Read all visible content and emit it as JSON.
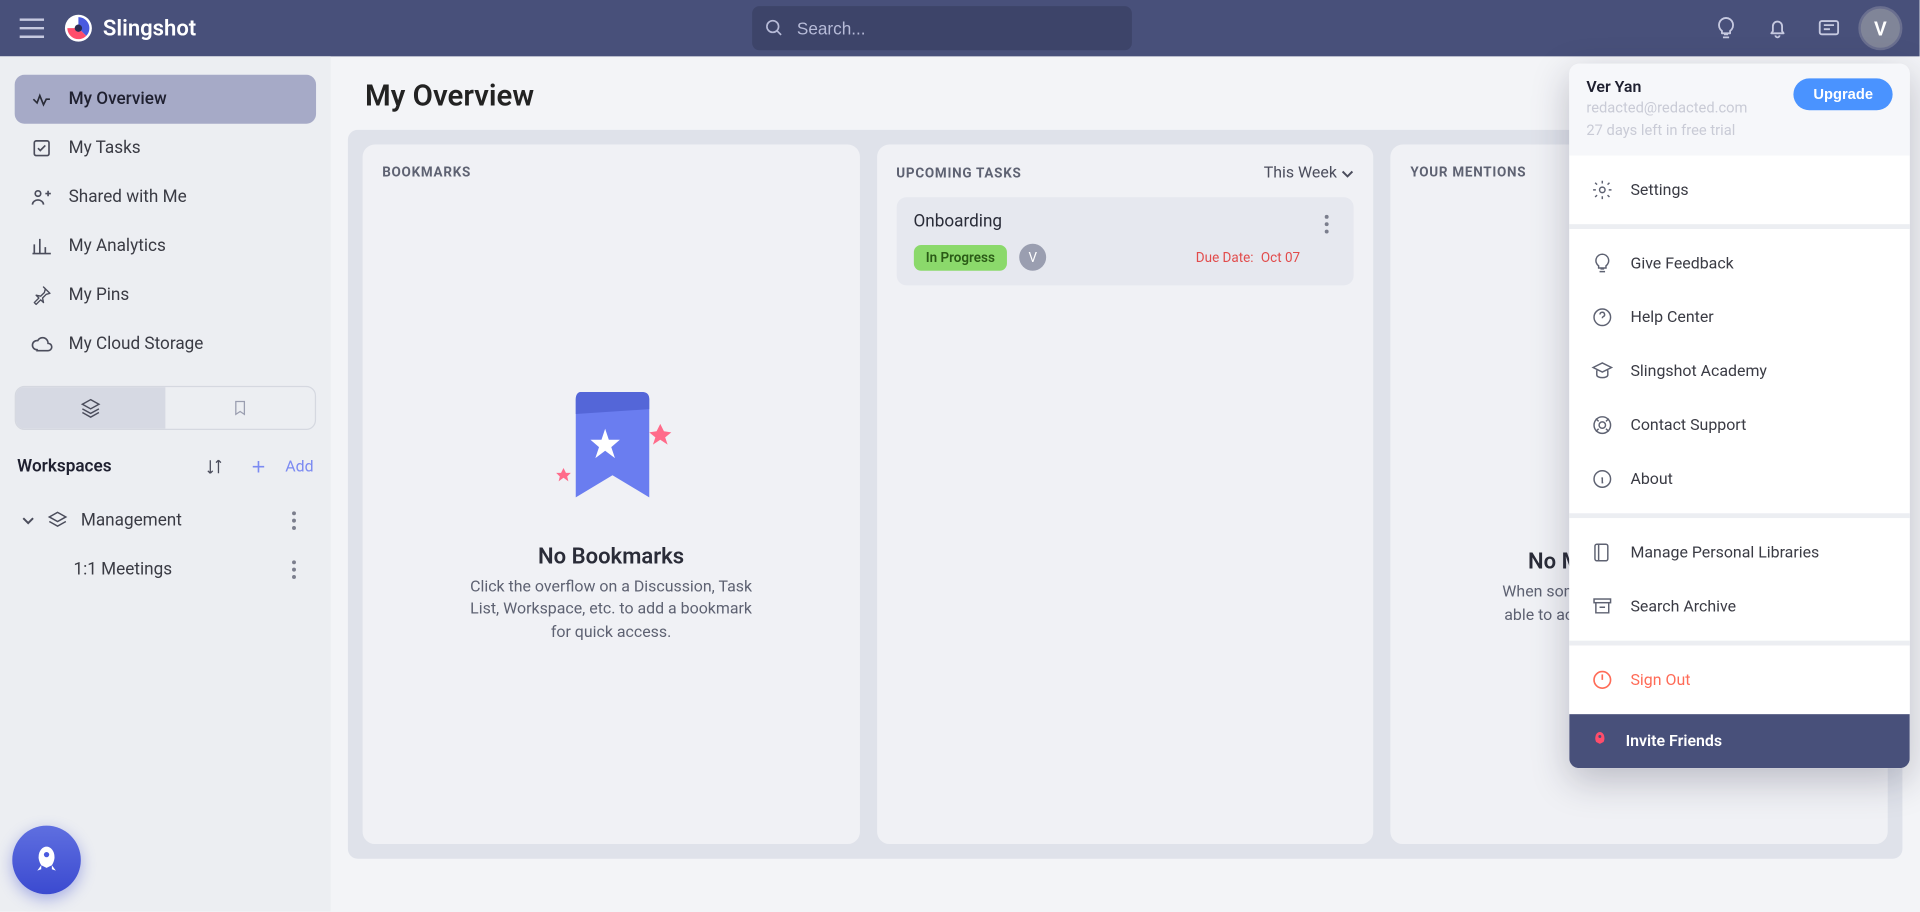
{
  "brand": "Slingshot",
  "search": {
    "placeholder": "Search..."
  },
  "avatar_initial": "V",
  "sidebar": {
    "items": [
      {
        "label": "My Overview"
      },
      {
        "label": "My Tasks"
      },
      {
        "label": "Shared with Me"
      },
      {
        "label": "My Analytics"
      },
      {
        "label": "My Pins"
      },
      {
        "label": "My Cloud Storage"
      }
    ],
    "workspaces_title": "Workspaces",
    "add_label": "Add",
    "ws": [
      {
        "label": "Management"
      },
      {
        "label": "1:1 Meetings"
      }
    ]
  },
  "page_title": "My Overview",
  "cards": {
    "bookmarks": {
      "title": "BOOKMARKS",
      "empty_title": "No Bookmarks",
      "empty_text": "Click the overflow on a Discussion, Task List, Workspace, etc. to add a bookmark for quick access."
    },
    "tasks": {
      "title": "UPCOMING TASKS",
      "filter": "This Week",
      "task": {
        "title": "Onboarding",
        "status": "In Progress",
        "assignee_initial": "V",
        "due_label": "Due Date:",
        "due_value": "Oct 07"
      }
    },
    "mentions": {
      "title": "YOUR MENTIONS",
      "empty_title": "No Mentions Currently",
      "empty_text": "When someone mentions you, you'll be able to access the message from here"
    }
  },
  "menu": {
    "name": "Ver Yan",
    "email": "redacted@redacted.com",
    "trial": "27 days left in free trial",
    "upgrade": "Upgrade",
    "items": {
      "settings": "Settings",
      "feedback": "Give Feedback",
      "help": "Help Center",
      "academy": "Slingshot Academy",
      "support": "Contact Support",
      "about": "About",
      "libraries": "Manage Personal Libraries",
      "archive": "Search Archive",
      "signout": "Sign Out",
      "invite": "Invite Friends"
    }
  }
}
